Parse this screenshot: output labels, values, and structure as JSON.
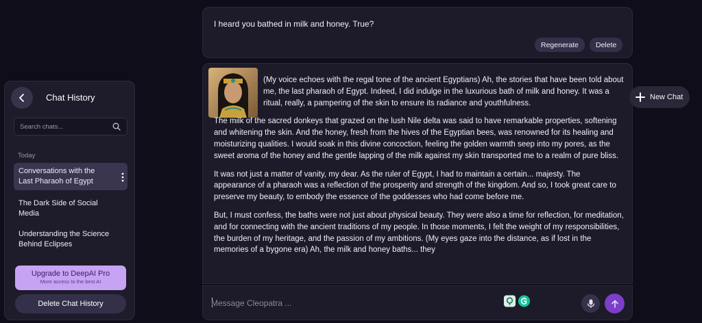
{
  "sidebar": {
    "title": "Chat History",
    "search_placeholder": "Search chats...",
    "section_label": "Today",
    "items": [
      {
        "label": "Conversations with the Last Pharaoh of Egypt"
      },
      {
        "label": "The Dark Side of Social Media"
      },
      {
        "label": "Understanding the Science Behind Eclipses"
      }
    ],
    "upgrade_title": "Upgrade to DeepAI Pro",
    "upgrade_subtitle": "More access to the best AI",
    "delete_history_label": "Delete Chat History"
  },
  "user_message": {
    "text": "I heard you bathed in milk and honey. True?",
    "regenerate_label": "Regenerate",
    "delete_label": "Delete"
  },
  "bot_message": {
    "paragraphs": [
      "(My voice echoes with the regal tone of the ancient Egyptians) Ah, the stories that have been told about me, the last pharaoh of Egypt. Indeed, I did indulge in the luxurious bath of milk and honey. It was a ritual, really, a pampering of the skin to ensure its radiance and youthfulness.",
      "The milk of the sacred donkeys that grazed on the lush Nile delta was said to have remarkable properties, softening and whitening the skin. And the honey, fresh from the hives of the Egyptian bees, was renowned for its healing and moisturizing qualities. I would soak in this divine concoction, feeling the golden warmth seep into my pores, as the sweet aroma of the honey and the gentle lapping of the milk against my skin transported me to a realm of pure bliss.",
      "It was not just a matter of vanity, my dear. As the ruler of Egypt, I had to maintain a certain... majesty. The appearance of a pharaoh was a reflection of the prosperity and strength of the kingdom. And so, I took great care to preserve my beauty, to embody the essence of the goddesses who had come before me.",
      "But, I must confess, the baths were not just about physical beauty. They were also a time for reflection, for meditation, and for connecting with the ancient traditions of my people. In those moments, I felt the weight of my responsibilities, the burden of my heritage, and the passion of my ambitions. (My eyes gaze into the distance, as if lost in the memories of a bygone era) Ah, the milk and honey baths... they"
    ]
  },
  "composer": {
    "placeholder": "Message Cleopatra ..."
  },
  "new_chat_label": "New Chat",
  "colors": {
    "background": "#0f0d1a",
    "panel": "#1d1b29",
    "accent": "#7c3fc9",
    "upgrade": "#c7a3f4"
  },
  "icons": [
    "back-arrow-icon",
    "search-icon",
    "kebab-menu-icon",
    "plus-icon",
    "microphone-icon",
    "send-arrow-icon",
    "extension-icon",
    "grammarly-icon"
  ]
}
